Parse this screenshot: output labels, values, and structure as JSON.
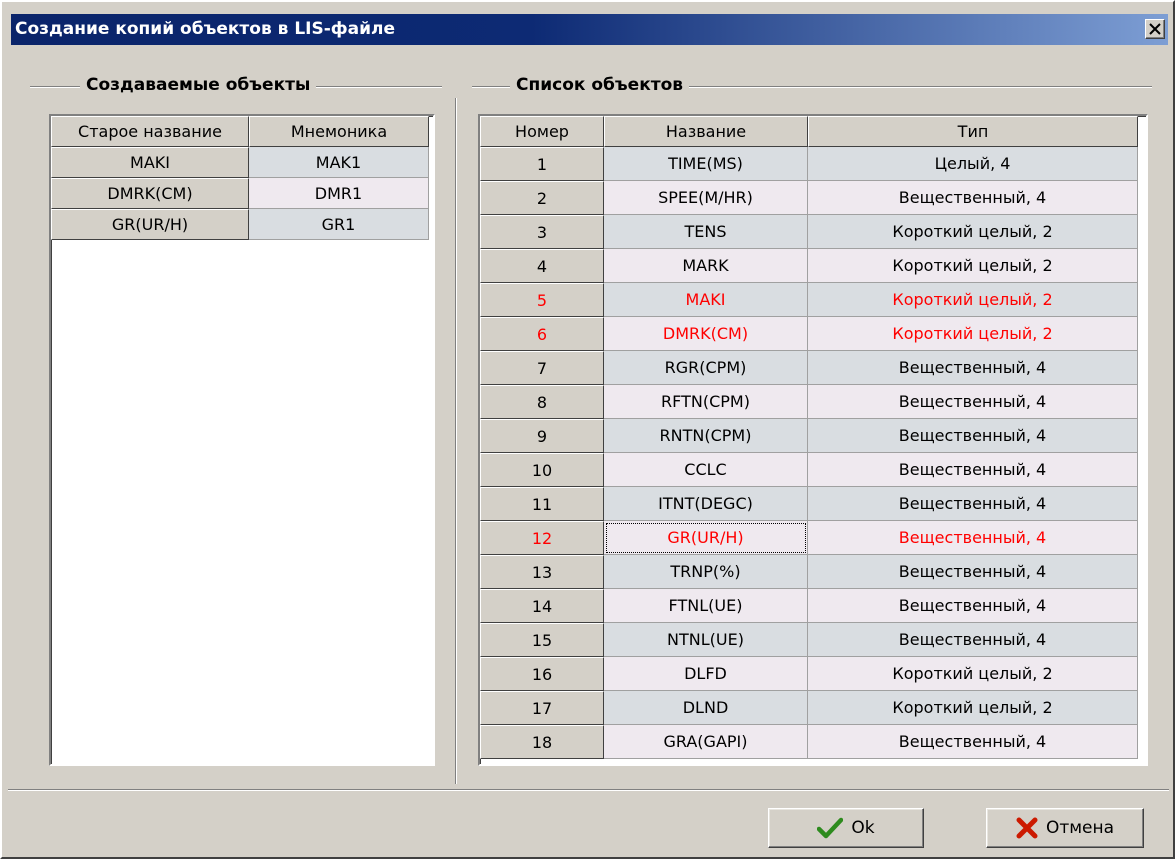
{
  "window": {
    "title": "Создание копий объектов в LIS-файле"
  },
  "left_group": {
    "label": "Создаваемые объекты",
    "headers": [
      "Старое название",
      "Мнемоника"
    ],
    "rows": [
      [
        "MAKI",
        "MAK1"
      ],
      [
        "DMRK(CM)",
        "DMR1"
      ],
      [
        "GR(UR/H)",
        "GR1"
      ]
    ]
  },
  "right_group": {
    "label": "Список объектов",
    "headers": [
      "Номер",
      "Название",
      "Тип"
    ],
    "rows": [
      [
        "1",
        "TIME(MS)",
        "Целый, 4"
      ],
      [
        "2",
        "SPEE(M/HR)",
        "Вещественный, 4"
      ],
      [
        "3",
        "TENS",
        "Короткий целый, 2"
      ],
      [
        "4",
        "MARK",
        "Короткий целый, 2"
      ],
      [
        "5",
        "MAKI",
        "Короткий целый, 2"
      ],
      [
        "6",
        "DMRK(CM)",
        "Короткий целый, 2"
      ],
      [
        "7",
        "RGR(CPM)",
        "Вещественный, 4"
      ],
      [
        "8",
        "RFTN(CPM)",
        "Вещественный, 4"
      ],
      [
        "9",
        "RNTN(CPM)",
        "Вещественный, 4"
      ],
      [
        "10",
        "CCLC",
        "Вещественный, 4"
      ],
      [
        "11",
        "ITNT(DEGC)",
        "Вещественный, 4"
      ],
      [
        "12",
        "GR(UR/H)",
        "Вещественный, 4"
      ],
      [
        "13",
        "TRNP(%)",
        "Вещественный, 4"
      ],
      [
        "14",
        "FTNL(UE)",
        "Вещественный, 4"
      ],
      [
        "15",
        "NTNL(UE)",
        "Вещественный, 4"
      ],
      [
        "16",
        "DLFD",
        "Короткий целый, 2"
      ],
      [
        "17",
        "DLND",
        "Короткий целый, 2"
      ],
      [
        "18",
        "GRA(GAPI)",
        "Вещественный, 4"
      ]
    ],
    "highlighted_rows": [
      5,
      6,
      12
    ],
    "focused_row": 12
  },
  "buttons": {
    "ok_label": "Ok",
    "cancel_label": "Отмена"
  },
  "colors": {
    "title_gradient_start": "#0a246a",
    "title_gradient_end": "#7d9ed4",
    "highlight_text": "#ff0000",
    "row_even_bg": "#d9dde1",
    "row_odd_bg": "#efe9ef",
    "ok_check": "#2e8b1e",
    "cancel_x": "#cc1a00"
  },
  "icons": {
    "close": "close-icon",
    "ok": "checkmark-icon",
    "cancel": "x-mark-icon"
  }
}
